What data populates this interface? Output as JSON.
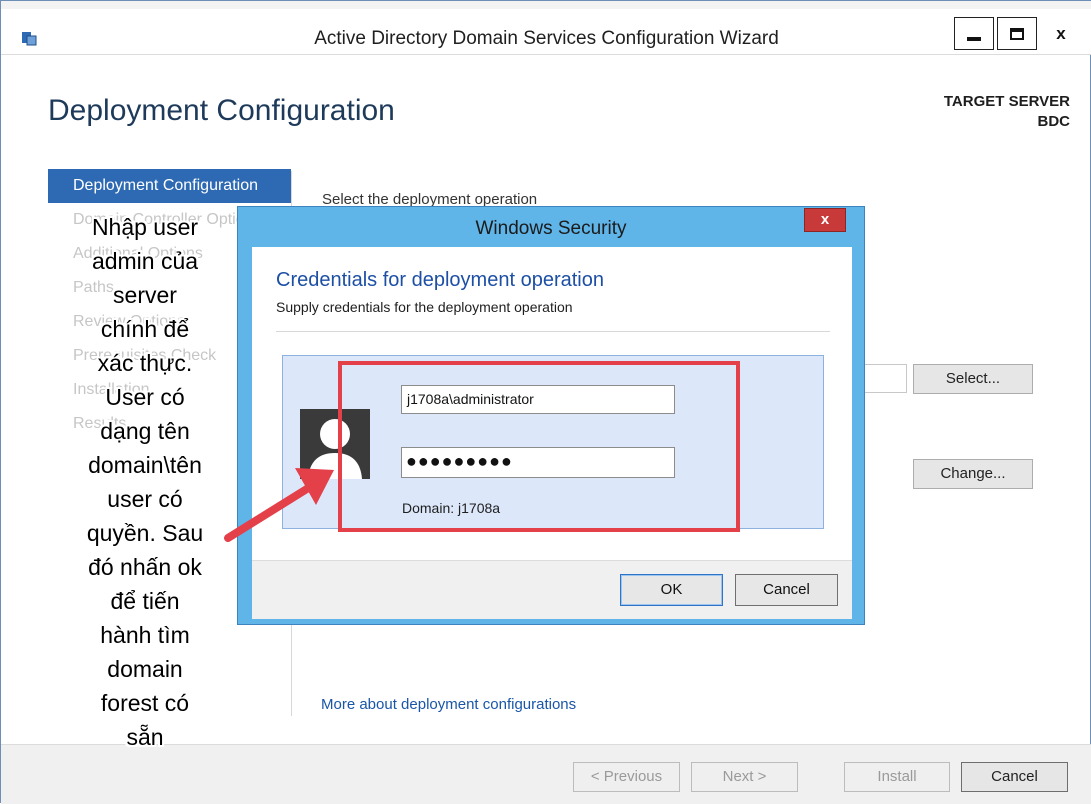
{
  "window": {
    "title": "Active Directory Domain Services Configuration Wizard",
    "minimize_glyph": "",
    "close_glyph": "x"
  },
  "page": {
    "heading": "Deployment Configuration",
    "target_server_label": "TARGET SERVER",
    "target_server_name": "BDC"
  },
  "nav": {
    "items": [
      {
        "label": "Deployment Configuration",
        "active": true
      },
      {
        "label": "Domain Controller Options",
        "active": false
      },
      {
        "label": "Additional Options",
        "active": false
      },
      {
        "label": "Paths",
        "active": false
      },
      {
        "label": "Review Options",
        "active": false
      },
      {
        "label": "Prerequisites Check",
        "active": false
      },
      {
        "label": "Installation",
        "active": false
      },
      {
        "label": "Results",
        "active": false
      }
    ]
  },
  "content": {
    "select_operation_label": "Select the deployment operation",
    "select_button": "Select...",
    "change_button": "Change...",
    "more_link": "More about deployment configurations"
  },
  "footer": {
    "previous": "< Previous",
    "next": "Next >",
    "install": "Install",
    "cancel": "Cancel"
  },
  "dialog": {
    "title": "Windows Security",
    "close_glyph": "x",
    "heading": "Credentials for deployment operation",
    "subheading": "Supply credentials for the deployment operation",
    "username": "j1708a\\administrator",
    "password_mask": "●●●●●●●●●",
    "domain_label": "Domain: j1708a",
    "ok": "OK",
    "cancel": "Cancel"
  },
  "annotation": {
    "text": "Nhập user\nadmin của\nserver\nchính để\nxác thực.\nUser có\ndạng tên\ndomain\\tên\nuser có\nquyền. Sau\nđó nhấn ok\nđể tiến\nhành tìm\ndomain\nforest có\nsẵn"
  },
  "colors": {
    "accent": "#2e6ab3",
    "dialog_frame": "#5fb4e8",
    "highlight": "#e4404a",
    "link": "#1a56a8"
  }
}
